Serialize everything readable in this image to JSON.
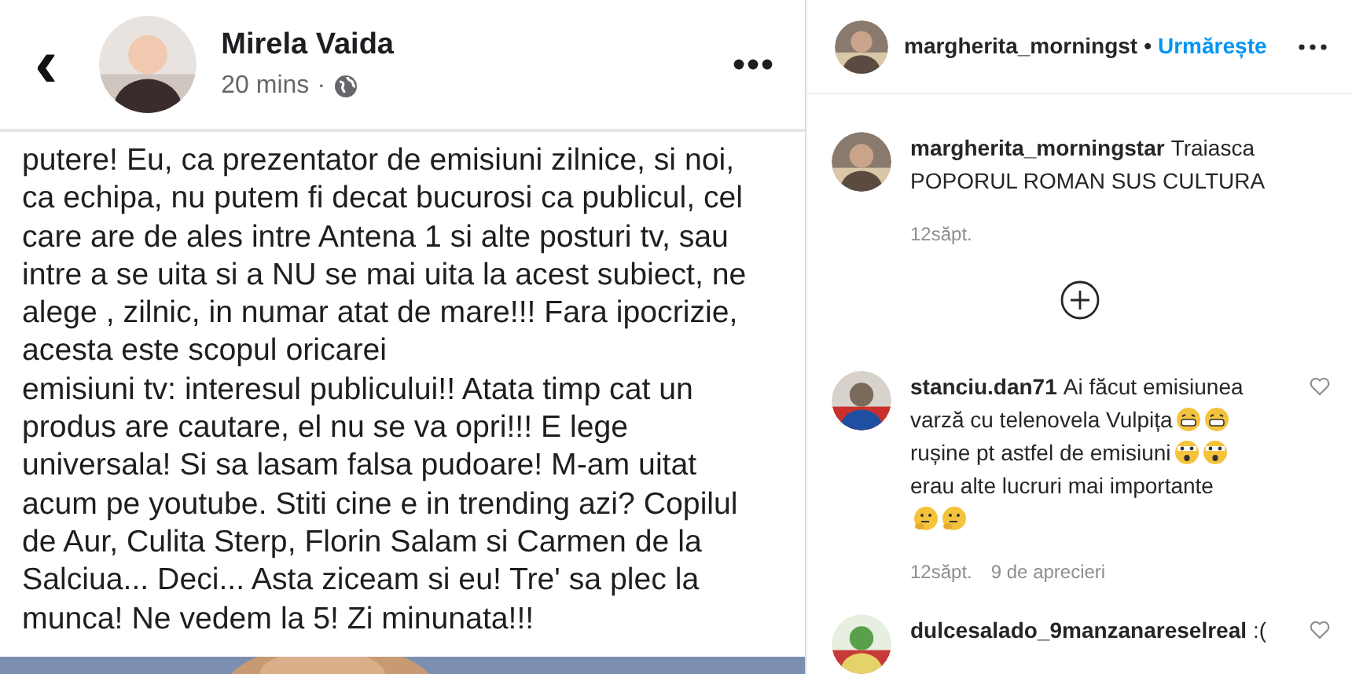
{
  "post": {
    "author": "Mirela Vaida",
    "time": "20 mins",
    "separator": "·",
    "back": "‹",
    "lines": [
      "putere! Eu, ca prezentator de emisiuni zilnice, si noi,",
      "ca echipa, nu putem fi decat bucurosi ca publicul, cel",
      "care are de ales intre Antena 1 si alte posturi tv, sau",
      "intre a se uita si a NU se mai uita la acest subiect, ne",
      "alege , zilnic, in numar atat de mare!!! Fara ipocrizie,",
      "acesta este scopul oricarei",
      "emisiuni tv: interesul publicului!! Atata timp cat un",
      "produs are cautare, el nu se va opri!!!   E lege",
      "universala! Si sa lasam falsa pudoare! M-am uitat",
      "acum pe youtube. Stiti cine e in trending azi? Copilul",
      "de Aur, Culita Sterp, Florin Salam si Carmen de la",
      "Salciua... Deci... Asta ziceam si eu! Tre' sa plec la",
      "munca! Ne vedem la 5! Zi minunata!!!"
    ]
  },
  "instagram": {
    "header": {
      "user": "margherita_morningst",
      "separator": "•",
      "follow": "Urmărește"
    },
    "caption": {
      "user": "margherita_morningstar",
      "lines": [
        "Traiasca",
        "POPORUL ROMAN SUS CULTURA"
      ],
      "time": "12săpt."
    },
    "comments": [
      {
        "user": "stanciu.dan71",
        "liked": false,
        "lines": [
          {
            "text": "Ai făcut emisiunea"
          },
          {
            "text": "varză cu telenovela Vulpița",
            "icons": [
              {
                "kind": "grin"
              },
              {
                "kind": "grin"
              }
            ]
          },
          {
            "text": "rușine pt astfel de emisiuni",
            "icons": [
              {
                "kind": "shock"
              },
              {
                "kind": "shock"
              }
            ]
          },
          {
            "text": "erau alte lucruri mai importante"
          },
          {
            "icons": [
              {
                "kind": "think"
              },
              {
                "kind": "think"
              }
            ]
          }
        ],
        "time": "12săpt.",
        "likes": "9 de aprecieri"
      },
      {
        "user": "dulcesalado_9manzanareselreal",
        "liked": false,
        "lines": [
          {
            "text": ":("
          }
        ]
      }
    ]
  }
}
